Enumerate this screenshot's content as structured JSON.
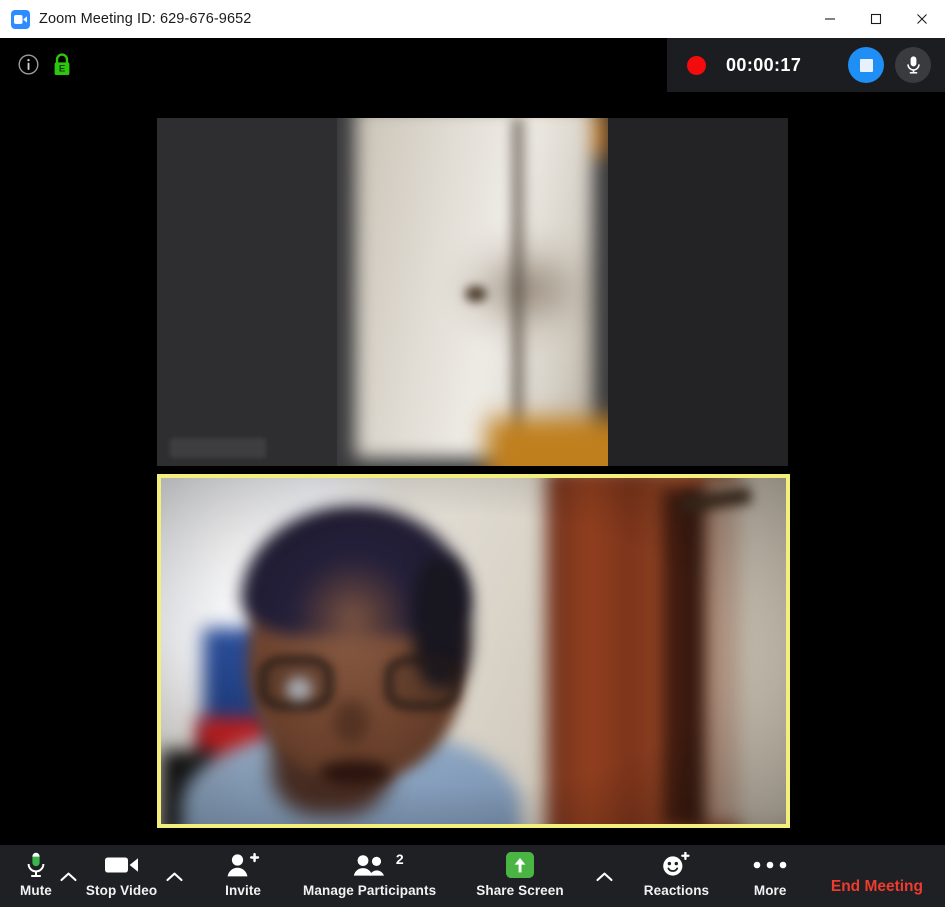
{
  "window": {
    "app_icon": "zoom-camera-icon",
    "title": "Zoom Meeting ID: 629-676-9652",
    "controls": {
      "minimize": "minimize-icon",
      "maximize": "maximize-icon",
      "close": "close-icon"
    }
  },
  "meeting_bar": {
    "info_icon": "info-icon",
    "encryption_icon": "green-lock-icon",
    "encryption_letter": "E"
  },
  "recording": {
    "indicator": "red-record-dot",
    "elapsed": "00:00:17",
    "stop_button": "stop-recording-icon",
    "mic_button": "microphone-icon",
    "stop_color": "#1f8ff5",
    "dot_color": "#f40b0b",
    "panel_bg": "#1c1d20"
  },
  "stage": {
    "background": "#000000",
    "tiles": [
      {
        "name": "participant-video-top",
        "active_speaker": false,
        "name_label": "",
        "background": "#2b2b2d"
      },
      {
        "name": "participant-video-bottom",
        "active_speaker": true,
        "border_color": "#f2ef7d",
        "name_label": ""
      }
    ]
  },
  "toolbar": {
    "background": "#1f2023",
    "items": [
      {
        "id": "mute",
        "label": "Mute",
        "icon": "microphone-green-icon",
        "has_caret": true
      },
      {
        "id": "stop-video",
        "label": "Stop Video",
        "icon": "video-camera-icon",
        "has_caret": true
      },
      {
        "id": "invite",
        "label": "Invite",
        "icon": "add-person-icon",
        "has_caret": false
      },
      {
        "id": "manage-participants",
        "label": "Manage Participants",
        "icon": "participants-icon",
        "count": "2",
        "has_caret": false
      },
      {
        "id": "share-screen",
        "label": "Share Screen",
        "icon": "share-screen-up-arrow-icon",
        "has_caret": true
      },
      {
        "id": "reactions",
        "label": "Reactions",
        "icon": "smiley-plus-icon",
        "has_caret": false
      },
      {
        "id": "more",
        "label": "More",
        "icon": "ellipsis-icon",
        "has_caret": false
      }
    ],
    "end_meeting_label": "End Meeting",
    "end_meeting_color": "#ee3b2f",
    "share_color": "#4bb543",
    "mic_green": "#39b54a"
  }
}
